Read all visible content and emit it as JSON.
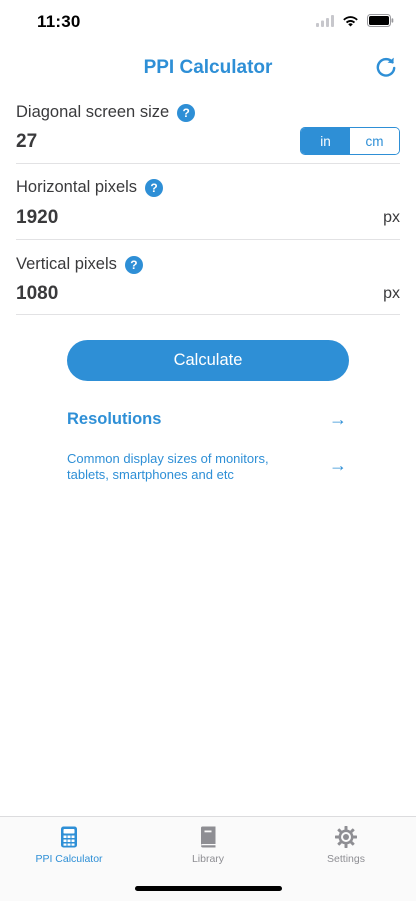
{
  "status": {
    "time": "11:30"
  },
  "nav": {
    "title": "PPI Calculator",
    "reset_icon": "refresh-icon"
  },
  "fields": {
    "diagonal": {
      "label": "Diagonal screen size",
      "value": "27",
      "units": [
        "in",
        "cm"
      ],
      "selected_unit": "in"
    },
    "horizontal": {
      "label": "Horizontal pixels",
      "value": "1920",
      "unit": "px"
    },
    "vertical": {
      "label": "Vertical pixels",
      "value": "1080",
      "unit": "px"
    }
  },
  "help_glyph": "?",
  "calculate_label": "Calculate",
  "resolutions": {
    "title": "Resolutions",
    "description": "Common display sizes of monitors, tablets, smartphones and etc",
    "arrow": "→"
  },
  "tabs": [
    {
      "label": "PPI Calculator",
      "icon": "calculator-icon",
      "active": true
    },
    {
      "label": "Library",
      "icon": "book-icon",
      "active": false
    },
    {
      "label": "Settings",
      "icon": "gear-icon",
      "active": false
    }
  ],
  "colors": {
    "accent": "#2e8fd6",
    "text": "#3a3a3c",
    "inactive": "#8e8e93"
  }
}
